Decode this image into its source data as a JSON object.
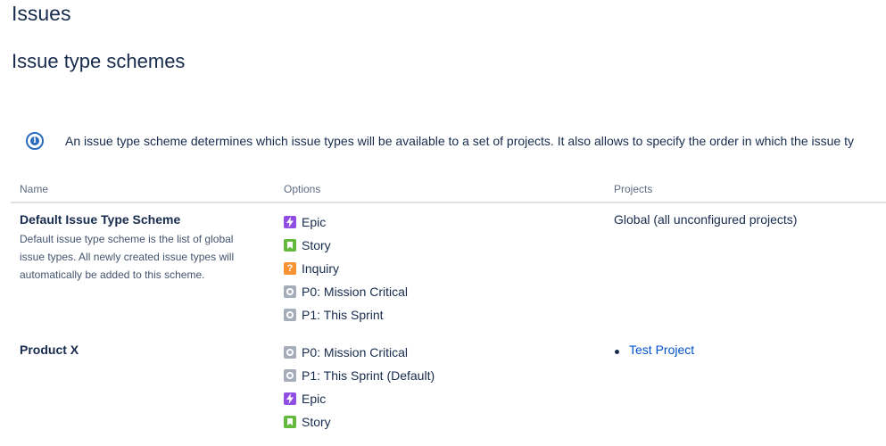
{
  "page": {
    "title": "Issues",
    "subtitle": "Issue type schemes"
  },
  "info": {
    "icon": "info-icon",
    "text": "An issue type scheme determines which issue types will be available to a set of projects. It also allows to specify the order in which the issue ty"
  },
  "table": {
    "headers": {
      "name": "Name",
      "options": "Options",
      "projects": "Projects"
    },
    "rows": [
      {
        "name": "Default Issue Type Scheme",
        "description": "Default issue type scheme is the list of global issue types. All newly created issue types will automatically be added to this scheme.",
        "options": [
          {
            "label": "Epic",
            "icon": "epic-icon"
          },
          {
            "label": "Story",
            "icon": "story-icon"
          },
          {
            "label": "Inquiry",
            "icon": "inquiry-icon"
          },
          {
            "label": "P0: Mission Critical",
            "icon": "generic-issue-icon"
          },
          {
            "label": "P1: This Sprint",
            "icon": "generic-issue-icon"
          }
        ],
        "projects": "Global (all unconfigured projects)"
      },
      {
        "name": "Product X",
        "options": [
          {
            "label": "P0: Mission Critical",
            "icon": "generic-issue-icon"
          },
          {
            "label": "P1: This Sprint (Default)",
            "icon": "generic-issue-icon"
          },
          {
            "label": "Epic",
            "icon": "epic-icon"
          },
          {
            "label": "Story",
            "icon": "story-icon"
          }
        ],
        "projects": [
          "Test Project"
        ]
      }
    ]
  },
  "colors": {
    "heading": "#172b4d",
    "link": "#0052cc",
    "info": "#2a6bbf",
    "epic": "#904ee2",
    "story": "#63ba3c",
    "inquiry": "#f79232",
    "generic": "#a5adba"
  }
}
